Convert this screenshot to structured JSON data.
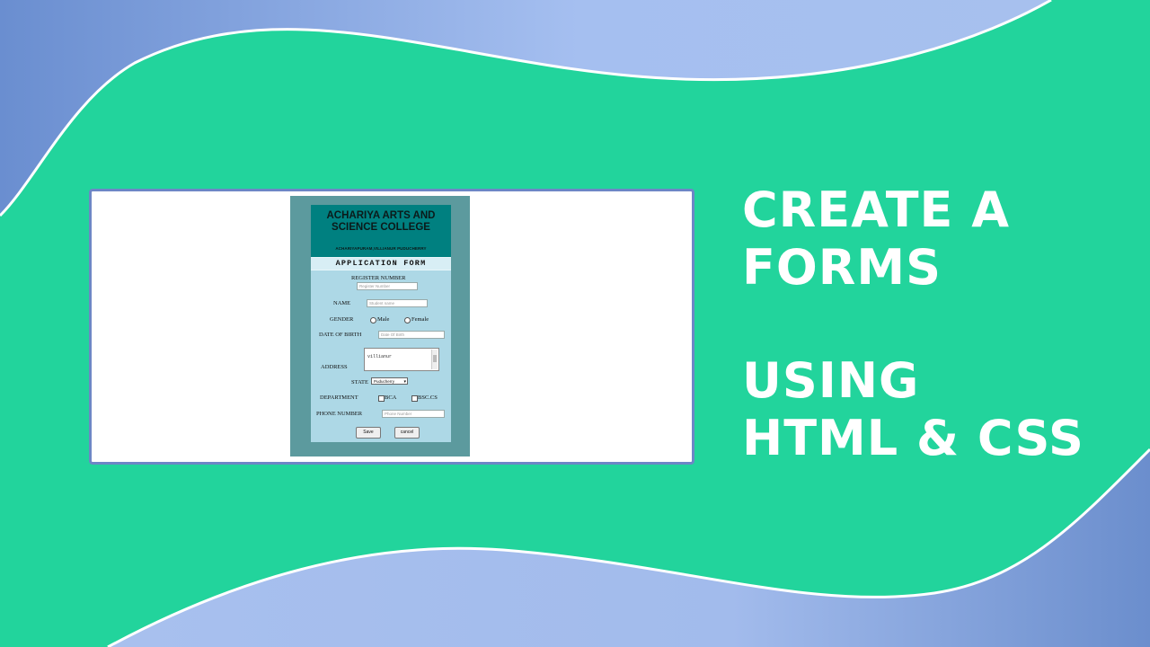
{
  "colors": {
    "background": "#22d49c",
    "wave": "#6e8fd0",
    "wave_light": "#a9c1ee",
    "card_border": "#6d86c6",
    "form_outer": "#5c9a9e",
    "form_header": "#008080",
    "form_body": "#add8e6"
  },
  "heading": {
    "line1": "CREATE A",
    "line2": "FORMS",
    "line3": "USING",
    "line4": "HTML & CSS"
  },
  "form": {
    "college_line1": "ACHARIYA ARTS AND",
    "college_line2": "SCIENCE COLLEGE",
    "college_address": "ACHARIYAPURAM,VILLIANUR PUDUCHERRY",
    "title": "APPLICATION FORM",
    "register_label": "REGISTER NUMBER",
    "register_placeholder": "Register Number",
    "name_label": "NAME",
    "name_placeholder": "Student name",
    "gender_label": "GENDER",
    "gender_options": [
      "Male",
      "Female"
    ],
    "dob_label": "DATE OF BIRTH",
    "dob_placeholder": "Date Of Birth",
    "address_label": "ADDRESS",
    "address_value": "villianur",
    "state_label": "STATE",
    "state_selected": "Puducherry",
    "department_label": "DEPARTMENT",
    "department_options": [
      "BCA",
      "BSC.CS"
    ],
    "phone_label": "PHONE NUMBER",
    "phone_placeholder": "Phone Number",
    "save_label": "Save",
    "cancel_label": "cancel"
  }
}
